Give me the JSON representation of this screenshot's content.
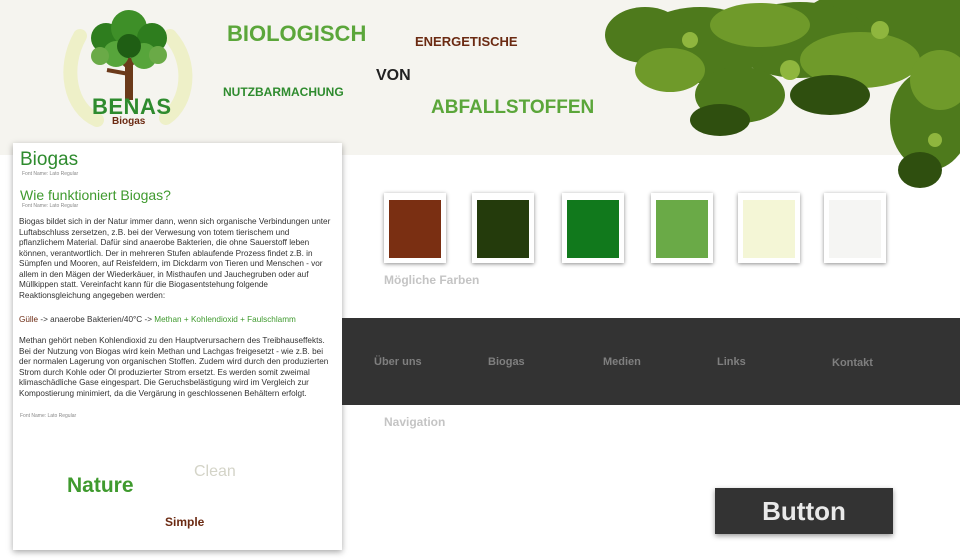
{
  "logo": {
    "name": "BENAS",
    "subtitle": "Biogas"
  },
  "headline": {
    "w1": "BIOLOGISCH",
    "w2": "ENERGETISCHE",
    "w3": "VON",
    "w4": "NUTZBARMACHUNG",
    "w5": "ABFALLSTOFFEN"
  },
  "card": {
    "title": "Biogas",
    "font_note": "Font Name: Lato Regular",
    "subtitle": "Wie funktioniert Biogas?",
    "paragraph1": "Biogas bildet sich in der Natur immer dann, wenn sich organische Verbindungen unter Luftabschluss zersetzen, z.B. bei der Verwesung von totem tierischem und pflanzlichem Material. Dafür sind anaerobe Bakterien, die ohne Sauerstoff leben können, verantwortlich. Der in mehreren Stufen ablaufende Prozess findet z.B. in Sümpfen und Mooren, auf Reisfeldern, im Dickdarm von Tieren und Menschen - vor allem in den Mägen der Wiederkäuer, in Misthaufen und Jauchegruben oder auf Müllkippen statt. Vereinfacht kann für die Biogasentstehung folgende Reaktionsgleichung angegeben werden:",
    "formula": {
      "input": "Gülle",
      "process": " -> anaerobe Bakterien/40°C -> ",
      "out1": "Methan",
      "plus": " + ",
      "out2": "Kohlendioxid",
      "out3": "Faulschlamm"
    },
    "paragraph2": "Methan gehört neben Kohlendioxid zu den Hauptverursachern des Treibhauseffekts. Bei der Nutzung von Biogas wird kein Methan und Lachgas freigesetzt - wie z.B. bei der normalen Lagerung von organischen Stoffen. Zudem wird durch den produzierten Strom durch Kohle oder Öl produzierter Strom ersetzt. Es werden somit zweimal klimaschädliche Gase eingespart. Die Geruchsbelästigung wird im Vergleich zur Kompostierung minimiert, da die Vergärung in geschlossenen Behältern erfolgt.",
    "keywords": {
      "clean": "Clean",
      "nature": "Nature",
      "simple": "Simple"
    }
  },
  "palette": {
    "caption": "Mögliche Farben",
    "colors": [
      "#7a2f12",
      "#243b0c",
      "#11791c",
      "#6aaa47",
      "#f4f6d6",
      "#f5f5f3"
    ]
  },
  "nav": {
    "caption": "Navigation",
    "items": [
      "Über uns",
      "Biogas",
      "Medien",
      "Links",
      "Kontakt"
    ]
  },
  "button": {
    "label": "Button"
  }
}
